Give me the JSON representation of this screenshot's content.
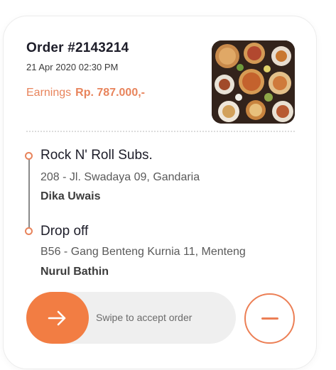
{
  "order": {
    "title": "Order #2143214",
    "date": "21 Apr 2020 02:30 PM",
    "earnings_label": "Earnings",
    "earnings_amount": "Rp. 787.000,-"
  },
  "pickup": {
    "name": "Rock N' Roll Subs.",
    "address": "208 - Jl. Swadaya 09, Gandaria",
    "person": "Dika Uwais"
  },
  "dropoff": {
    "name": "Drop off",
    "address": "B56 - Gang Benteng Kurnia 11, Menteng",
    "person": "Nurul Bathin"
  },
  "actions": {
    "swipe_label": "Swipe to accept order",
    "swipe_icon": "arrow-right-icon",
    "reject_icon": "minus-icon"
  },
  "colors": {
    "accent": "#f27d43",
    "earnings": "#e8845c",
    "title": "#1d1d29"
  }
}
